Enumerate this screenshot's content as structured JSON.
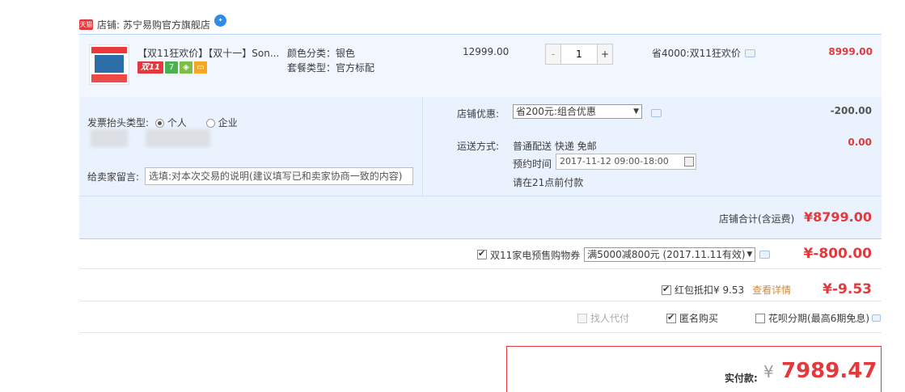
{
  "shop": {
    "label": "店铺:",
    "name": "苏宁易购官方旗舰店",
    "logo_text": "天猫"
  },
  "item": {
    "title": "【双11狂欢价】【双十一】Son...",
    "badge_double11": "双11",
    "badge_7": "7",
    "sku_color": "颜色分类：银色",
    "sku_package": "套餐类型：官方标配",
    "price": "12999.00",
    "qty": "1",
    "minus": "-",
    "plus": "+",
    "promo": "省4000:双11狂欢价",
    "subtotal": "8999.00"
  },
  "invoice": {
    "label": "发票抬头类型:",
    "opt_personal": "个人",
    "opt_company": "企业",
    "selected": "个人"
  },
  "message": {
    "label": "给卖家留言:",
    "placeholder": "选填:对本次交易的说明(建议填写已和卖家协商一致的内容)"
  },
  "shop_discount": {
    "label": "店铺优惠:",
    "selected": "省200元:组合优惠",
    "value": "-200.00"
  },
  "shipping": {
    "label": "运送方式:",
    "method": "普通配送 快递 免邮",
    "appt_label": "预约时间",
    "appt_value": "2017-11-12 09:00-18:00",
    "pay_before": "请在21点前付款",
    "value": "0.00"
  },
  "shop_total": {
    "label": "店铺合计(含运费)",
    "value": "¥8799.00"
  },
  "coupon": {
    "label": "双11家电预售购物券",
    "selected": "满5000减800元 (2017.11.11有效)",
    "value": "¥-800.00",
    "checked": true
  },
  "hongbao": {
    "label": "红包抵扣¥ 9.53",
    "link": "查看详情",
    "value": "¥-9.53",
    "checked": true
  },
  "options": {
    "proxy_pay": "找人代付",
    "anonymous": "匿名购买",
    "installment": "花呗分期(最高6期免息)"
  },
  "total": {
    "label": "实付款:",
    "currency": "¥",
    "value": "7989.47"
  },
  "colors": {
    "accent": "#e4393c",
    "panel": "#eaf2fe",
    "row": "#f2f7ff"
  }
}
